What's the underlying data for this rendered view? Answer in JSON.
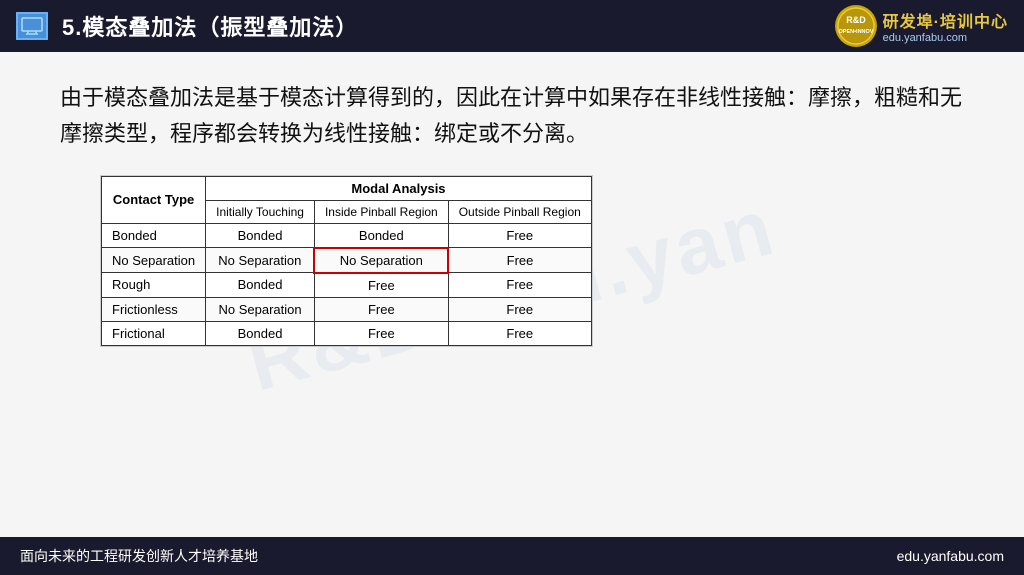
{
  "header": {
    "title": "5.模态叠加法（振型叠加法）",
    "logo_text": "R&D",
    "logo_sub": "OPEN • INNOVATION",
    "logo_brand": "研发埠·培训中心",
    "logo_url": "edu.yanfabu.com"
  },
  "content": {
    "paragraph": "由于模态叠加法是基于模态计算得到的，因此在计算中如果存在非线性接触：摩擦，粗糙和无摩擦类型，程序都会转换为线性接触：绑定或不分离。",
    "watermark": "R&D edu.yan"
  },
  "table": {
    "caption": "Modal Analysis",
    "contact_type_label": "Contact Type",
    "col_initially": "Initially Touching",
    "col_inside": "Inside Pinball Region",
    "col_outside": "Outside Pinball Region",
    "rows": [
      {
        "type": "Bonded",
        "initially": "Bonded",
        "inside": "Bonded",
        "outside": "Free",
        "highlight_inside": false
      },
      {
        "type": "No Separation",
        "initially": "No Separation",
        "inside": "No Separation",
        "outside": "Free",
        "highlight_inside": true
      },
      {
        "type": "Rough",
        "initially": "Bonded",
        "inside": "Free",
        "outside": "Free",
        "highlight_inside": false
      },
      {
        "type": "Frictionless",
        "initially": "No Separation",
        "inside": "Free",
        "outside": "Free",
        "highlight_inside": false
      },
      {
        "type": "Frictional",
        "initially": "Bonded",
        "inside": "Free",
        "outside": "Free",
        "highlight_inside": false
      }
    ]
  },
  "footer": {
    "left": "面向未来的工程研发创新人才培养基地",
    "right": "edu.yanfabu.com"
  }
}
